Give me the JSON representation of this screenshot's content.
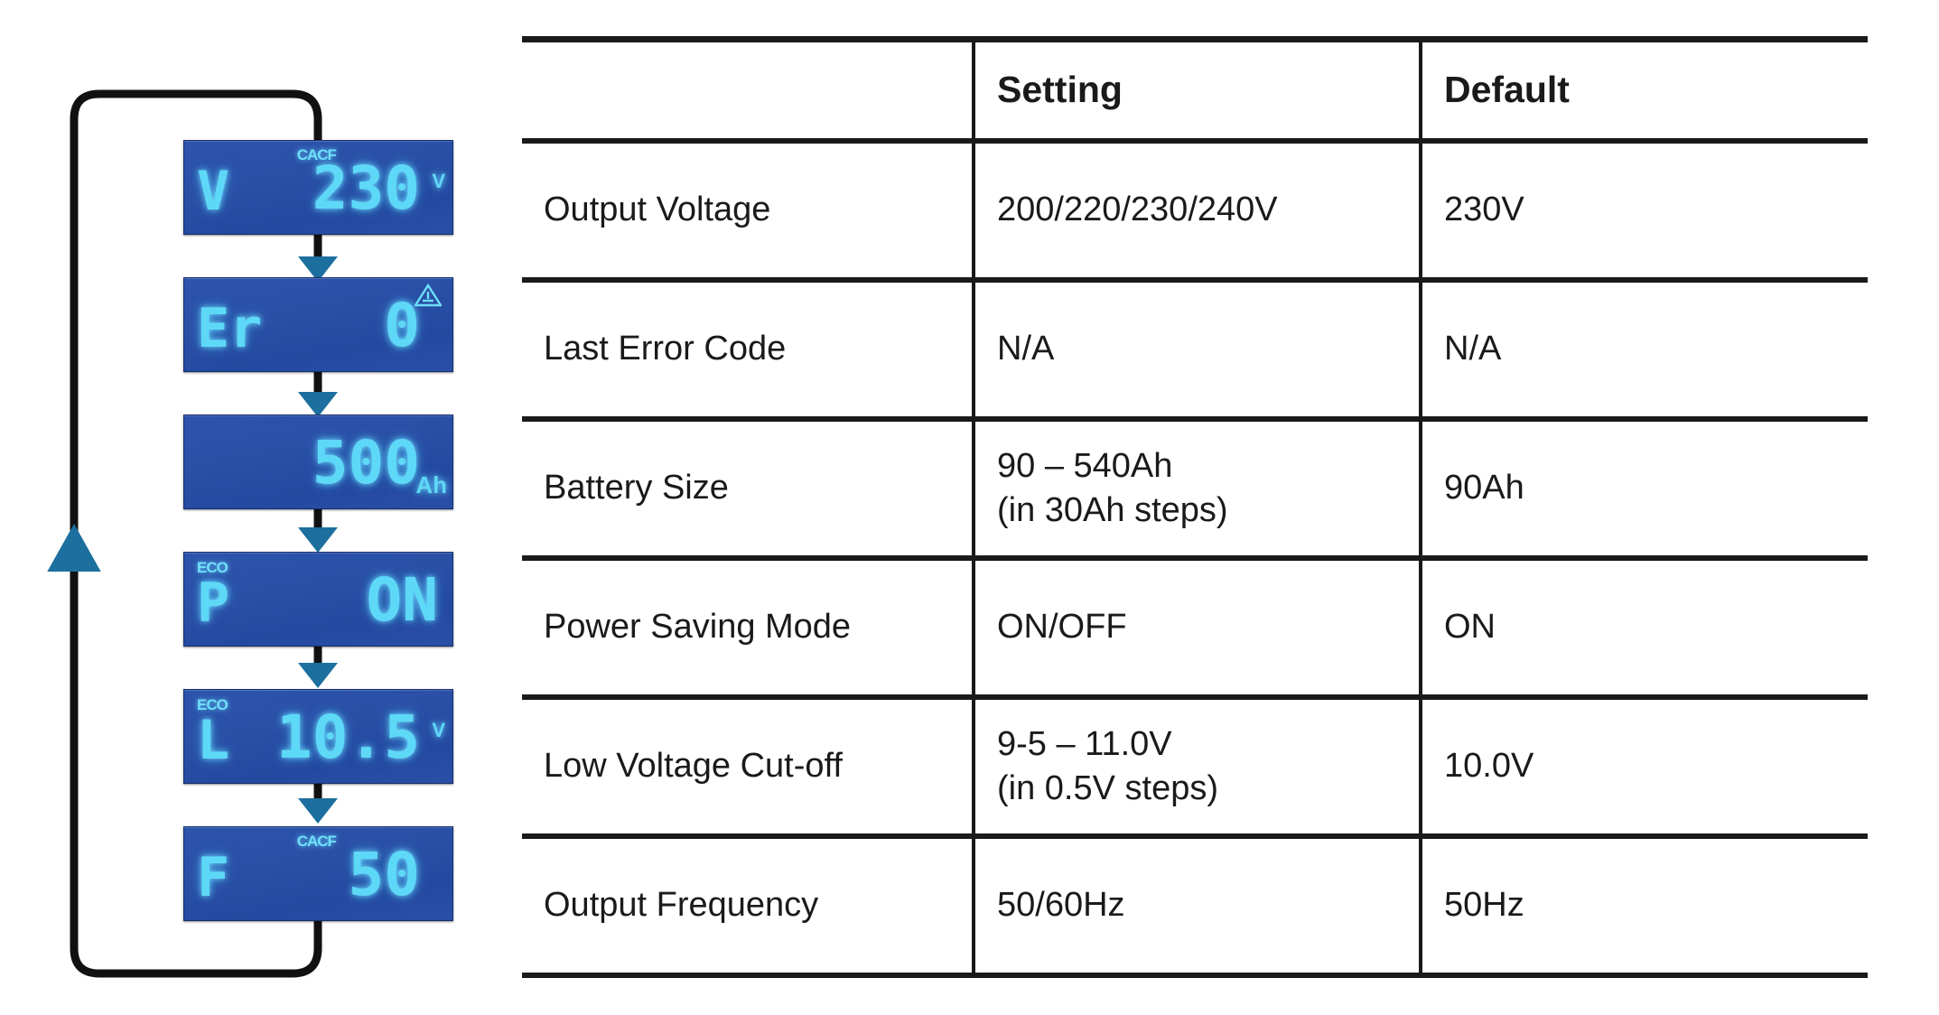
{
  "diagram": {
    "title": "LCD setting menu cycle",
    "loop_arrow_name": "loop-back-arrow",
    "colors": {
      "lcd_background": "#2a50a6",
      "lcd_segment": "#5ed8f7",
      "arrow_blue": "#1a6f9e",
      "line_black": "#111111"
    },
    "screens": [
      {
        "id": "output-voltage",
        "label": "V",
        "value": "230",
        "unit": "V",
        "indicator": "CACF",
        "indicator_position": "top-center",
        "indicator_icon": "ac-mode-icon"
      },
      {
        "id": "last-error-code",
        "label": "Er",
        "value": "0",
        "unit": "",
        "indicator": "",
        "indicator_position": "top-right",
        "indicator_icon": "warning-triangle-icon"
      },
      {
        "id": "battery-size",
        "label": "",
        "value": "500",
        "unit": "Ah",
        "indicator": "",
        "indicator_position": "none",
        "indicator_icon": ""
      },
      {
        "id": "power-saving-mode",
        "label": "P",
        "value": "ON",
        "unit": "",
        "indicator": "ECO",
        "indicator_position": "top-left",
        "indicator_icon": "eco-icon"
      },
      {
        "id": "low-voltage-cutoff",
        "label": "L",
        "value": "10.5",
        "unit": "V",
        "indicator": "ECO",
        "indicator_position": "top-left",
        "indicator_icon": "eco-icon"
      },
      {
        "id": "output-frequency",
        "label": "F",
        "value": "50",
        "unit": "",
        "indicator": "CACF",
        "indicator_position": "top-center",
        "indicator_icon": "ac-mode-icon"
      }
    ],
    "step_arrows": 5,
    "step_arrow_name": "down-arrow-icon",
    "return_arrow_name": "up-arrow-icon"
  },
  "table": {
    "columns": [
      "",
      "Setting",
      "Default"
    ],
    "rows": [
      {
        "name": "Output Voltage",
        "setting": [
          "200/220/230/240V"
        ],
        "default": "230V"
      },
      {
        "name": "Last Error Code",
        "setting": [
          "N/A"
        ],
        "default": "N/A"
      },
      {
        "name": "Battery Size",
        "setting": [
          "90 – 540Ah",
          "(in 30Ah steps)"
        ],
        "default": "90Ah"
      },
      {
        "name": "Power Saving Mode",
        "setting": [
          "ON/OFF"
        ],
        "default": "ON"
      },
      {
        "name": "Low Voltage Cut-off",
        "setting": [
          "9-5 – 11.0V",
          "(in 0.5V steps)"
        ],
        "default": "10.0V"
      },
      {
        "name": "Output Frequency",
        "setting": [
          "50/60Hz"
        ],
        "default": "50Hz"
      }
    ]
  }
}
